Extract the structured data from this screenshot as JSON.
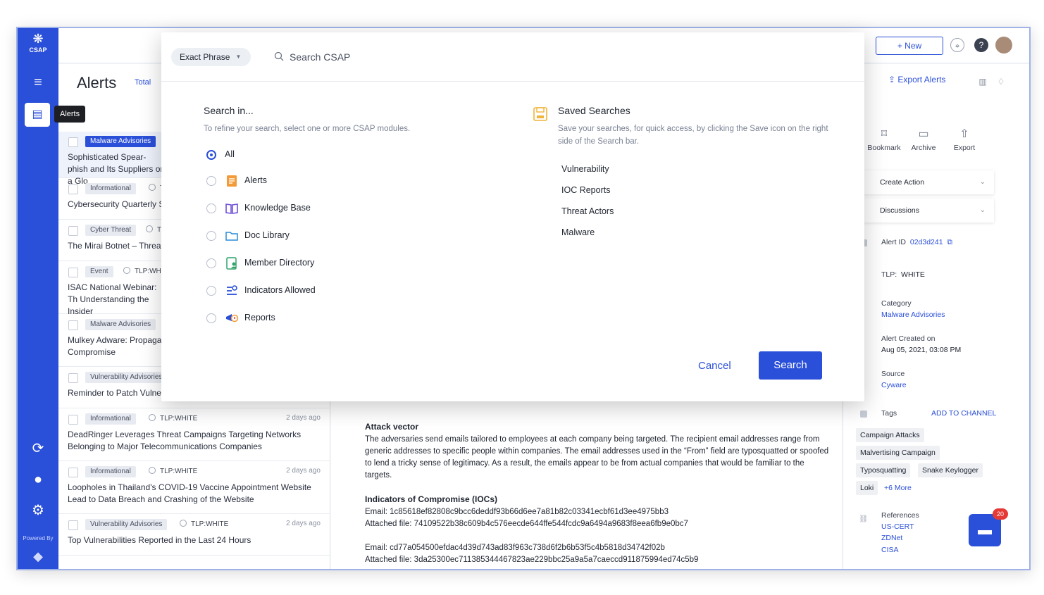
{
  "brand": {
    "name": "CSAP",
    "powered_by": "Powered By"
  },
  "nav": {
    "tooltip": "Alerts"
  },
  "topbar": {
    "new_label": "New"
  },
  "page": {
    "title": "Alerts",
    "total_label": "Total",
    "export_label": "Export Alerts"
  },
  "list": [
    {
      "badge": "Malware Advisories",
      "tlp": "",
      "ago": "",
      "title": "Sophisticated Spear-phish and Its Suppliers on a Glo",
      "selected": true
    },
    {
      "badge": "Informational",
      "tlp": "T",
      "ago": "",
      "title": "Cybersecurity Quarterly Su"
    },
    {
      "badge": "Cyber Threat",
      "tlp": "TL",
      "ago": "",
      "title": "The Mirai Botnet – Threat"
    },
    {
      "badge": "Event",
      "tlp": "TLP:WHI",
      "ago": "",
      "title": "ISAC National Webinar: Th Understanding the Insider"
    },
    {
      "badge": "Malware Advisories",
      "tlp": "",
      "ago": "",
      "title": "Mulkey Adware: Propagati Compromise"
    },
    {
      "badge": "Vulnerability Advisories",
      "tlp": "",
      "ago": "",
      "title": "Reminder to Patch Vulnera"
    },
    {
      "badge": "Informational",
      "tlp": "TLP:WHITE",
      "ago": "2 days ago",
      "title": "DeadRinger Leverages Threat Campaigns Targeting Networks Belonging to Major Telecommunications Companies"
    },
    {
      "badge": "Informational",
      "tlp": "TLP:WHITE",
      "ago": "2 days ago",
      "title": "Loopholes in Thailand's COVID-19 Vaccine Appointment Website Lead to Data Breach and Crashing of the Website"
    },
    {
      "badge": "Vulnerability Advisories",
      "tlp": "TLP:WHITE",
      "ago": "2 days ago",
      "title": "Top Vulnerabilities Reported in the Last 24 Hours"
    }
  ],
  "detail": {
    "attack_vector_heading": "Attack vector",
    "attack_vector_text": "The adversaries send emails tailored to employees at each company being targeted. The recipient email addresses range from generic addresses to specific people within companies. The email addresses used in the “From” field are typosquatted or spoofed to lend a tricky sense of legitimacy. As a result, the emails appear to be from actual companies that would be familiar to the targets.",
    "ioc_heading": "Indicators of Compromise (IOCs)",
    "ioc_email_1": "Email: 1c85618ef82808c9bcc6deddf93b66d6ee7a81b82c03341ecbf61d3ee4975bb3",
    "ioc_file_1": "Attached file: 74109522b38c609b4c576eecde644ffe544fcdc9a6494a9683f8eea6fb9e0bc7",
    "ioc_email_2": "Email: cd77a054500efdac4d39d743ad83f963c738d6f2b6b53f5c4b5818d34742f02b",
    "ioc_file_2": "Attached file: 3da25300ec711385344467823ae229bbc25a9a5a7caeccd911875994ed74c5b9"
  },
  "right": {
    "actions": [
      "Bookmark",
      "Archive",
      "Export"
    ],
    "create_action": "Create Action",
    "discussions": "Discussions",
    "alert_id_label": "Alert ID",
    "alert_id": "02d3d241",
    "tlp_label": "TLP:",
    "tlp_value": "WHITE",
    "category_label": "Category",
    "category_value": "Malware Advisories",
    "created_label": "Alert Created on",
    "created_value": "Aug 05, 2021, 03:08 PM",
    "source_label": "Source",
    "source_value": "Cyware",
    "tags_label": "Tags",
    "add_to_channel": "ADD TO CHANNEL",
    "tags": [
      "Campaign Attacks",
      "Malvertising Campaign",
      "Typosquatting",
      "Snake Keylogger",
      "Loki"
    ],
    "more_tags": "+6 More",
    "references_label": "References",
    "references": [
      "US-CERT",
      "ZDNet",
      "CISA"
    ],
    "chat_count": "20"
  },
  "modal": {
    "phrase_mode": "Exact Phrase",
    "search_placeholder": "Search CSAP",
    "search_in_title": "Search in...",
    "search_in_sub": "To refine your search, select one or more CSAP modules.",
    "modules": [
      "All",
      "Alerts",
      "Knowledge Base",
      "Doc Library",
      "Member Directory",
      "Indicators Allowed",
      "Reports"
    ],
    "saved_title": "Saved Searches",
    "saved_sub": "Save your searches, for quick access, by clicking the Save icon on the right side of the Search bar.",
    "saved_items": [
      "Vulnerability",
      "IOC Reports",
      "Threat Actors",
      "Malware"
    ],
    "cancel_label": "Cancel",
    "search_label": "Search"
  },
  "colors": {
    "primary": "#2a4fd8",
    "nav_bg": "#2a4fd8",
    "badge_red": "#e53935"
  }
}
